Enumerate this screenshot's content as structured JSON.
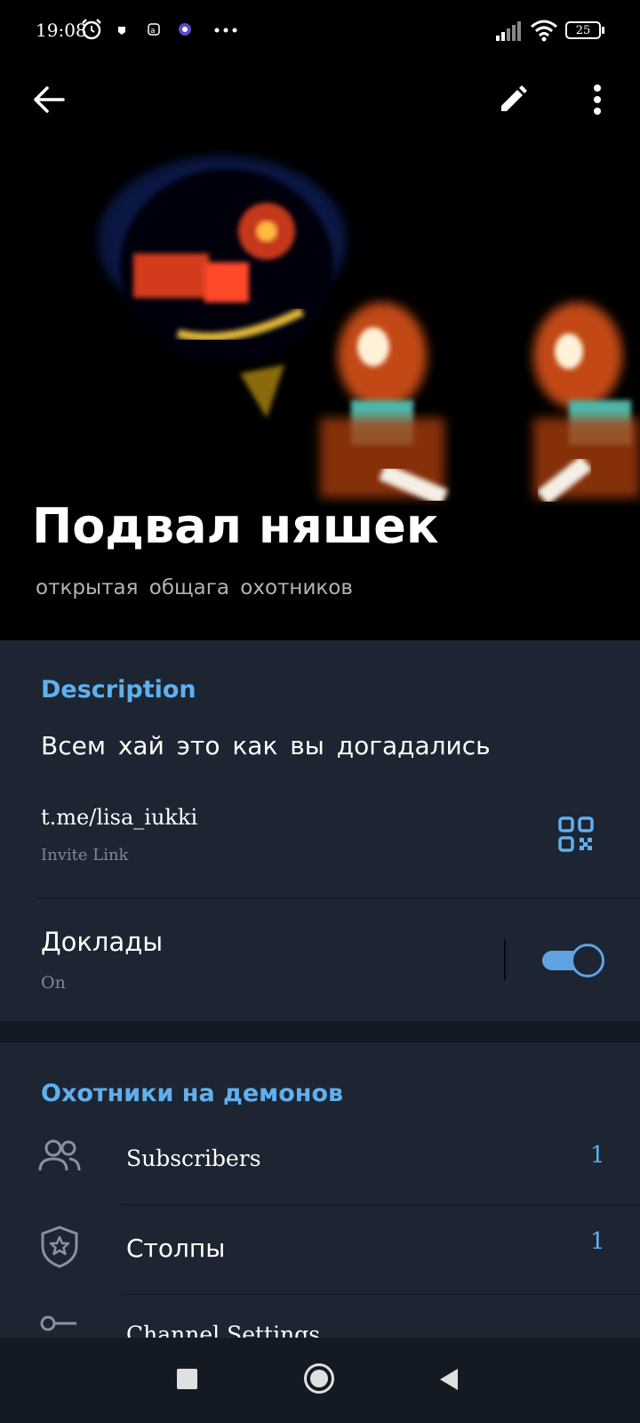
{
  "status": {
    "time": "19:08",
    "battery": "25"
  },
  "header": {
    "title": "Подвал няшек",
    "subtitle": "открытая общага охотников"
  },
  "description_section": {
    "title": "Description",
    "text": "Всем хай это как вы догадались",
    "link": "t.me/lisa_iukki",
    "link_caption": "Invite Link"
  },
  "reports": {
    "label": "Доклады",
    "state": "On",
    "enabled": true
  },
  "group_section": {
    "title": "Охотники на демонов",
    "rows": [
      {
        "label": "Subscribers",
        "count": "1"
      },
      {
        "label": "Столпы",
        "count": "1"
      },
      {
        "label": "Channel Settings",
        "count": ""
      }
    ]
  },
  "colors": {
    "accent": "#5fb0ee",
    "background": "#1d2533",
    "header_bg": "#000000"
  }
}
